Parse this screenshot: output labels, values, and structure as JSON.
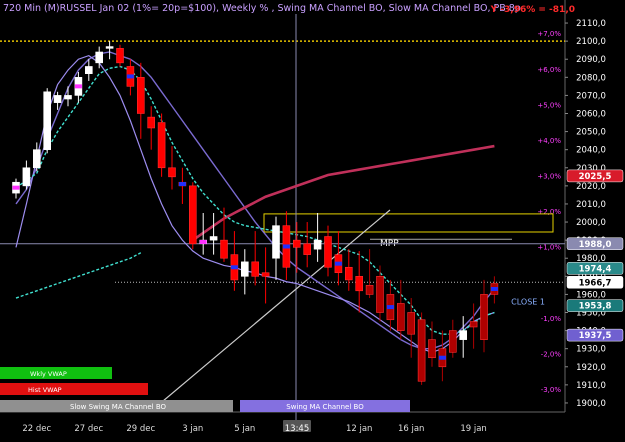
{
  "header": {
    "title": "720 Min (M)RUSSEL Jan 02 (1%= 20p=$100), Weekly % , Swing MA Channel BO, Slow MA Channel BO, PB 8p",
    "readout": "Y -3,96% = -81,0"
  },
  "colors": {
    "background": "#000000",
    "up_candle": "#ffffff",
    "down_candle": "#ff0000",
    "down_candle_dark": "#b00000",
    "cyan_line": "#40e0d0",
    "purple_line": "#8a7fe0",
    "slow_ma": "#c0305a",
    "dotted_gold": "#e6c200",
    "axis_text": "#ff40ff",
    "price_text": "#ffffff"
  },
  "price_axis": {
    "ticks": [
      "2110,0",
      "2100,0",
      "2090,0",
      "2080,0",
      "2070,0",
      "2060,0",
      "2050,0",
      "2040,0",
      "2030,0",
      "2020,0",
      "2010,0",
      "2000,0",
      "1990,0",
      "1980,0",
      "1970,0",
      "1960,0",
      "1950,0",
      "1940,0",
      "1930,0",
      "1920,0",
      "1910,0",
      "1900,0"
    ],
    "tick_values": [
      2110,
      2100,
      2090,
      2080,
      2070,
      2060,
      2050,
      2040,
      2030,
      2020,
      2010,
      2000,
      1990,
      1980,
      1970,
      1960,
      1950,
      1940,
      1930,
      1920,
      1910,
      1900
    ],
    "markers": [
      {
        "label": "2025,5",
        "value": 2025.5,
        "color": "#d81b2b"
      },
      {
        "label": "1988,0",
        "value": 1988.0,
        "color": "#8a8ab0"
      },
      {
        "label": "1974,4",
        "value": 1974.4,
        "color": "#2a8a8a"
      },
      {
        "label": "1966,7",
        "value": 1966.7,
        "color": "#ffffff"
      },
      {
        "label": "1953,8",
        "value": 1953.8,
        "color": "#1a7a7a"
      },
      {
        "label": "1937,5",
        "value": 1937.5,
        "color": "#7060d0"
      }
    ]
  },
  "percent_axis": {
    "ticks": [
      "+7,0%",
      "+6,0%",
      "+5,0%",
      "+4,0%",
      "+3,0%",
      "+2,0%",
      "+1,0%",
      "-1,0%",
      "-2,0%",
      "-3,0%"
    ],
    "tick_values": [
      7,
      6,
      5,
      4,
      3,
      2,
      1,
      -1,
      -2,
      -3
    ]
  },
  "time_axis": {
    "labels": [
      "22 dec",
      "27 dec",
      "29 dec",
      "3 jan",
      "5 jan",
      "13:45",
      "12 jan",
      "16 jan",
      "19 jan"
    ],
    "label_index": [
      2,
      7,
      12,
      17,
      22,
      28,
      33,
      38,
      44
    ]
  },
  "annotations": {
    "mpp": "MPP",
    "close": "CLOSE 1"
  },
  "legend": {
    "wkly_vwap": "Wkly VWAP",
    "hist_vwap": "Hist VWAP",
    "slow_channel": "Slow Swing MA Channel BO",
    "swing_channel": "Swing MA Channel BO"
  },
  "chart_data": {
    "type": "candlestick",
    "title": "720 Min (M)RUSSEL Jan 02 (1%= 20p=$100), Weekly % , Swing MA Channel BO, Slow MA Channel BO, PB 8p",
    "y_range": [
      1895,
      2115
    ],
    "candles": [
      {
        "o": 2016,
        "h": 2024,
        "l": 2013,
        "c": 2022
      },
      {
        "o": 2020,
        "h": 2034,
        "l": 2018,
        "c": 2030
      },
      {
        "o": 2030,
        "h": 2044,
        "l": 2028,
        "c": 2040
      },
      {
        "o": 2040,
        "h": 2074,
        "l": 2038,
        "c": 2072
      },
      {
        "o": 2066,
        "h": 2072,
        "l": 2062,
        "c": 2070
      },
      {
        "o": 2068,
        "h": 2075,
        "l": 2064,
        "c": 2070
      },
      {
        "o": 2070,
        "h": 2083,
        "l": 2066,
        "c": 2080
      },
      {
        "o": 2082,
        "h": 2090,
        "l": 2078,
        "c": 2086
      },
      {
        "o": 2088,
        "h": 2097,
        "l": 2085,
        "c": 2094
      },
      {
        "o": 2096,
        "h": 2100,
        "l": 2090,
        "c": 2097
      },
      {
        "o": 2096,
        "h": 2098,
        "l": 2086,
        "c": 2088
      },
      {
        "o": 2086,
        "h": 2090,
        "l": 2070,
        "c": 2075
      },
      {
        "o": 2080,
        "h": 2088,
        "l": 2046,
        "c": 2060
      },
      {
        "o": 2058,
        "h": 2064,
        "l": 2040,
        "c": 2052
      },
      {
        "o": 2055,
        "h": 2060,
        "l": 2025,
        "c": 2030
      },
      {
        "o": 2030,
        "h": 2042,
        "l": 2018,
        "c": 2025
      },
      {
        "o": 2022,
        "h": 2030,
        "l": 2010,
        "c": 2020
      },
      {
        "o": 2020,
        "h": 2022,
        "l": 1985,
        "c": 1988
      },
      {
        "o": 1988,
        "h": 2005,
        "l": 1982,
        "c": 1990
      },
      {
        "o": 1990,
        "h": 2005,
        "l": 1982,
        "c": 1992
      },
      {
        "o": 1990,
        "h": 2008,
        "l": 1978,
        "c": 1980
      },
      {
        "o": 1982,
        "h": 1995,
        "l": 1962,
        "c": 1968
      },
      {
        "o": 1970,
        "h": 1985,
        "l": 1960,
        "c": 1978
      },
      {
        "o": 1978,
        "h": 1995,
        "l": 1965,
        "c": 1970
      },
      {
        "o": 1972,
        "h": 1986,
        "l": 1955,
        "c": 1970
      },
      {
        "o": 1980,
        "h": 2003,
        "l": 1968,
        "c": 1998
      },
      {
        "o": 1998,
        "h": 2006,
        "l": 1968,
        "c": 1975
      },
      {
        "o": 1990,
        "h": 2000,
        "l": 1972,
        "c": 1986
      },
      {
        "o": 1988,
        "h": 2000,
        "l": 1975,
        "c": 1982
      },
      {
        "o": 1985,
        "h": 2005,
        "l": 1978,
        "c": 1990
      },
      {
        "o": 1992,
        "h": 1998,
        "l": 1970,
        "c": 1975
      },
      {
        "o": 1982,
        "h": 1995,
        "l": 1965,
        "c": 1972
      },
      {
        "o": 1975,
        "h": 1985,
        "l": 1962,
        "c": 1968
      },
      {
        "o": 1970,
        "h": 1984,
        "l": 1950,
        "c": 1962
      },
      {
        "o": 1965,
        "h": 1985,
        "l": 1958,
        "c": 1960
      },
      {
        "o": 1970,
        "h": 1976,
        "l": 1945,
        "c": 1950
      },
      {
        "o": 1960,
        "h": 1968,
        "l": 1940,
        "c": 1946
      },
      {
        "o": 1955,
        "h": 1968,
        "l": 1935,
        "c": 1940
      },
      {
        "o": 1950,
        "h": 1958,
        "l": 1925,
        "c": 1938
      },
      {
        "o": 1946,
        "h": 1950,
        "l": 1910,
        "c": 1912
      },
      {
        "o": 1935,
        "h": 1945,
        "l": 1920,
        "c": 1925
      },
      {
        "o": 1930,
        "h": 1940,
        "l": 1912,
        "c": 1920
      },
      {
        "o": 1940,
        "h": 1946,
        "l": 1925,
        "c": 1928
      },
      {
        "o": 1935,
        "h": 1948,
        "l": 1925,
        "c": 1940
      },
      {
        "o": 1945,
        "h": 1955,
        "l": 1930,
        "c": 1942
      },
      {
        "o": 1960,
        "h": 1968,
        "l": 1928,
        "c": 1935
      },
      {
        "o": 1966,
        "h": 1970,
        "l": 1955,
        "c": 1960
      }
    ],
    "series": [
      {
        "name": "cyan",
        "values": [
          2019,
          2023,
          2027,
          2040,
          2050,
          2058,
          2066,
          2074,
          2082,
          2085,
          2086,
          2084,
          2078,
          2068,
          2056,
          2044,
          2034,
          2024,
          2016,
          2010,
          2004,
          2000,
          1998,
          1997,
          1996,
          1995,
          1994,
          1993,
          1992,
          1990,
          1988,
          1986,
          1984,
          1982,
          1978,
          1972,
          1966,
          1960,
          1954,
          1946,
          1940,
          1938,
          1938,
          1940,
          1944,
          1948,
          1950
        ]
      },
      {
        "name": "purple",
        "values": [
          1986,
          2010,
          2035,
          2060,
          2076,
          2084,
          2090,
          2092,
          2088,
          2080,
          2070,
          2056,
          2040,
          2024,
          2010,
          1998,
          1990,
          1984,
          1980,
          1978,
          1976,
          1975,
          1973,
          1972,
          1970,
          1969,
          1967,
          1966,
          1964,
          1962,
          1960,
          1958,
          1956,
          1953,
          1950,
          1946,
          1942,
          1938,
          1934,
          1930,
          1928,
          1930,
          1934,
          1940,
          1945,
          1948,
          1950
        ]
      },
      {
        "name": "slow",
        "values": [
          2010,
          2018,
          2030,
          2046,
          2060,
          2074,
          2084,
          2090,
          2093,
          2094,
          2092,
          2090,
          2086,
          2080,
          2072,
          2064,
          2056,
          2048,
          2040,
          2032,
          2024,
          2016,
          2008,
          2000,
          1993,
          1986,
          1980,
          1975,
          1971,
          1967,
          1963,
          1959,
          1955,
          1951,
          1947,
          1943,
          1939,
          1935,
          1932,
          1930,
          1930,
          1932,
          1936,
          1942,
          1948,
          1956,
          1963
        ]
      },
      {
        "name": "slow_ma",
        "values": [
          null,
          null,
          null,
          null,
          null,
          null,
          null,
          null,
          null,
          null,
          null,
          null,
          null,
          null,
          null,
          null,
          null,
          1990,
          1994,
          1998,
          2002,
          2005,
          2008,
          2011,
          2014,
          2016,
          2018,
          2020,
          2022,
          2024,
          2026,
          2027,
          2028,
          2029,
          2030,
          2031,
          2032,
          2033,
          2034,
          2035,
          2036,
          2037,
          2038,
          2039,
          2040,
          2041,
          2042
        ]
      }
    ],
    "hlines": [
      {
        "name": "dotted_gold",
        "value": 2100
      },
      {
        "name": "crosshair",
        "value": 1988
      }
    ],
    "mpp_box": {
      "from_index": 27,
      "to_index": 47,
      "low": 1994.5,
      "high": 2004.5
    }
  }
}
